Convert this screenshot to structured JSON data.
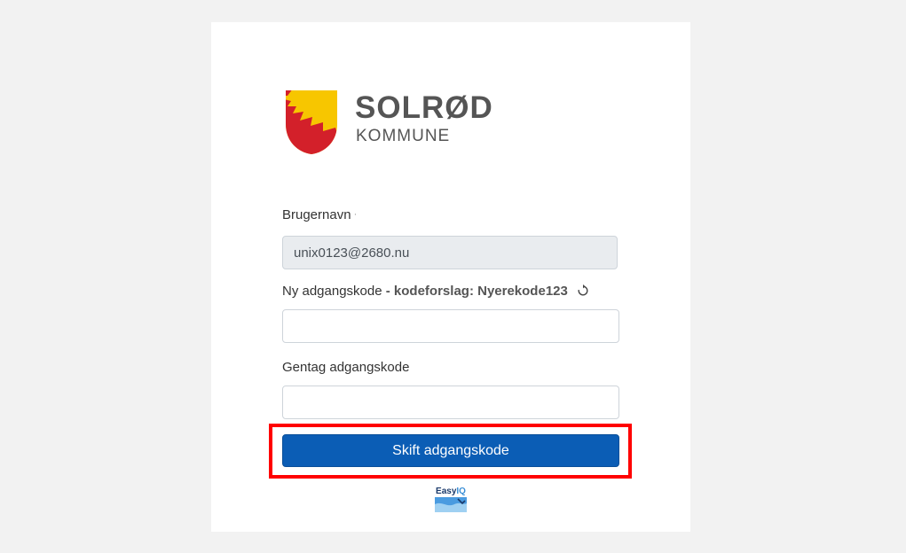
{
  "brand": {
    "name": "SOLRØD",
    "subtitle": "KOMMUNE",
    "colors": {
      "red": "#d3202a",
      "yellow": "#f7c600"
    }
  },
  "form": {
    "username_label": "Brugernavn",
    "username_required_marker": "·",
    "username_value": "unix0123@2680.nu",
    "new_password_label": "Ny adgangskode",
    "new_password_hint": " - kodeforslag: Nyerekode123",
    "new_password_value": "",
    "repeat_password_label": "Gentag adgangskode",
    "repeat_password_value": "",
    "submit_label": "Skift adgangskode"
  },
  "footer": {
    "logo_text_easy": "Easy",
    "logo_text_iq": "IQ"
  },
  "colors": {
    "primary": "#0b5db5",
    "highlight": "#ff0000",
    "background": "#f2f2f2"
  },
  "icons": [
    "refresh-icon",
    "shield-logo-icon",
    "easyiq-logo-icon"
  ]
}
